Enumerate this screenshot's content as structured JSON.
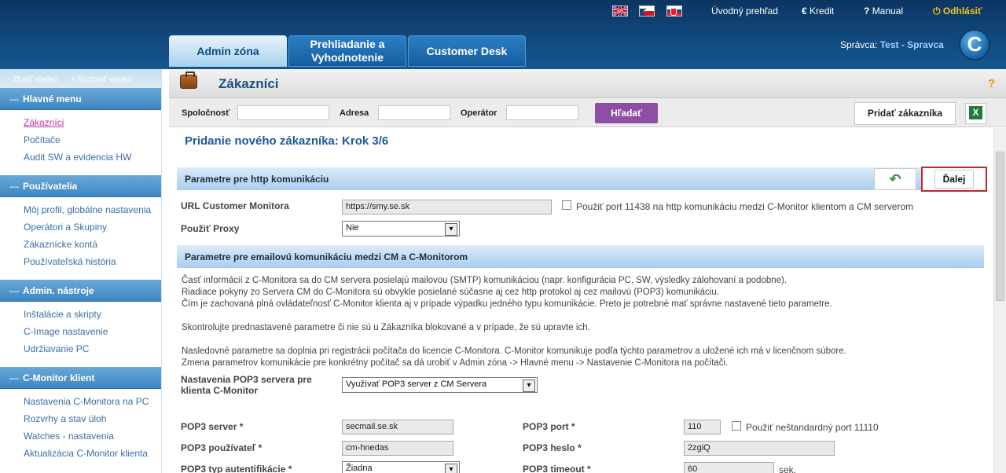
{
  "header": {
    "flags": [
      "english-flag-icon",
      "czech-flag-icon",
      "slovak-flag-icon"
    ],
    "links": {
      "home": "Úvodný prehľad",
      "credit": "Kredit",
      "manual": "Manual",
      "logout": "Odhlásiť"
    },
    "admin_prefix": "Správca:",
    "admin_user": "Test - Spravca",
    "logo": "C"
  },
  "tabs": {
    "admin": "Admin zóna",
    "review": "Prehliadanie a Vyhodnotenie",
    "desk": "Customer Desk"
  },
  "sidebar": {
    "collapse_all": "- Zbaliť všetko",
    "expand_all": "+ Rozbaliť všetko",
    "sections": [
      {
        "title": "Hlavné menu",
        "items": [
          "Zákazníci",
          "Počítače",
          "Audit SW a evidencia HW"
        ]
      },
      {
        "title": "Používatelia",
        "items": [
          "Môj profil, globálne nastavenia",
          "Operátori a Skupiny",
          "Zákaznícke kontá",
          "Používateľská história"
        ]
      },
      {
        "title": "Admin. nástroje",
        "items": [
          "Inštalácie a skripty",
          "C-Image nastavenie",
          "Udržiavanie PC"
        ]
      },
      {
        "title": "C-Monitor klient",
        "items": [
          "Nastavenia C-Monitora na PC",
          "Rozvrhy a stav úloh",
          "Watches - nastavenia",
          "Aktualizácia C-Monitor klienta"
        ]
      }
    ]
  },
  "page": {
    "title": "Zákazníci",
    "help": "?"
  },
  "search": {
    "company_label": "Spoločnosť",
    "address_label": "Adresa",
    "operator_label": "Operátor",
    "search_button": "Hľadať",
    "add_button": "Pridať zákazníka"
  },
  "form": {
    "step_title": "Pridanie nového zákazníka: Krok 3/6",
    "next_button": "Ďalej",
    "http_band": "Parametre pre http komunikáciu",
    "url_label": "URL Customer Monitora",
    "url_value": "https://smy.se.sk",
    "port_check_label": "Použiť port 11438 na http komunikáciu medzi C-Monitor klientom a CM serverom",
    "proxy_label": "Použiť Proxy",
    "proxy_value": "Nie",
    "email_band": "Parametre pre emailovú komunikáciu medzi CM a C-Monitorom",
    "info_lines": [
      "Časť informácií z C-Monitora sa do CM servera posielajú mailovou (SMTP) komunikáciou (napr. konfigurácia PC, SW, výsledky zálohovaní a podobne).",
      "Riadiace pokyny zo Servera CM do C-Monitora sú obvykle posielané súčasne aj cez http protokol aj cez mailovú (POP3) komunikáciu.",
      "Čím je zachovaná plná ovládateľnosť C-Monitor klienta aj v prípade výpadku jedného typu komunikácie. Preto je potrebné mať správne nastavené tieto parametre.",
      "Skontrolujte prednastavené parametre či nie sú u Zákazníka blokované a v prípade, že sú upravte ich.",
      "Nasledovné parametre sa doplnia pri registrácii počítača do licencie C-Monitora. C-Monitor komunikuje podľa týchto parametrov a uložené ich má v licenčnom súbore.",
      "Zmena parametrov komunikácie pre konkrétny počítač sa dá urobiť v Admin zóna -> Hlavné menu -> Nastavenie C-Monitora na počítači."
    ],
    "pop3_setting_label": "Nastavenia POP3 servera pre klienta C-Monitor",
    "pop3_setting_value": "Využívať POP3 server z CM Servera",
    "pop3_server_label": "POP3 server *",
    "pop3_server_value": "secmail.se.sk",
    "pop3_port_label": "POP3 port *",
    "pop3_port_value": "110",
    "pop3_port_check_label": "Použiť neštandardný port 11110",
    "pop3_user_label": "POP3 používateľ *",
    "pop3_user_value": "cm-hnedas",
    "pop3_pass_label": "POP3 heslo *",
    "pop3_pass_value": "2zgiQ",
    "pop3_auth_label": "POP3 typ autentifikácie *",
    "pop3_auth_value": "Žiadna",
    "pop3_timeout_label": "POP3 timeout *",
    "pop3_timeout_value": "60",
    "pop3_timeout_unit": "sek."
  }
}
